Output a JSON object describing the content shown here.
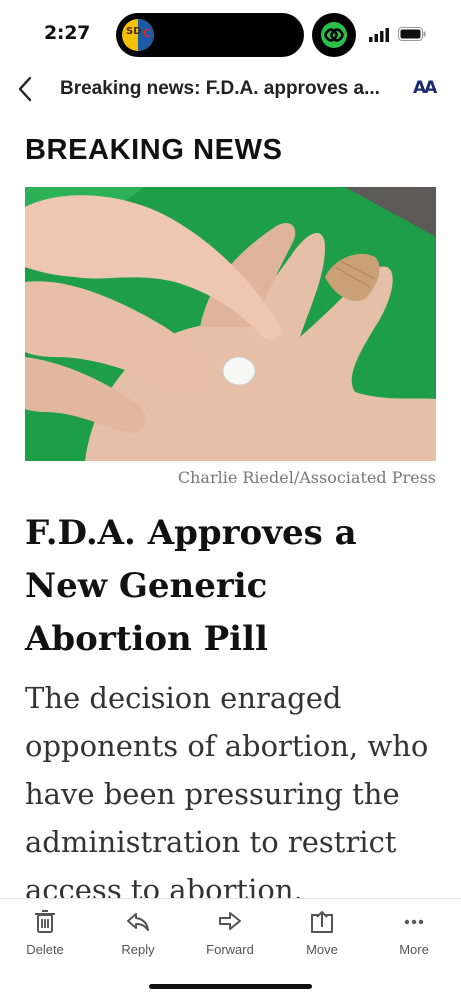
{
  "status_bar": {
    "time": "2:27",
    "island_app_logo_letters": "SD",
    "island_app_logo_letter_right": "C",
    "accent_green": "#2ac04a"
  },
  "nav": {
    "title": "Breaking news: F.D.A. approves a...",
    "text_size_label": "AA"
  },
  "article": {
    "kicker": "BREAKING NEWS",
    "photo_credit": "Charlie Riedel/Associated Press",
    "headline": "F.D.A. Approves a New Generic Abortion Pill",
    "summary": "The decision enraged opponents of abortion, who have been pressuring the administration to restrict access to abortion."
  },
  "toolbar": {
    "items": [
      {
        "label": "Delete",
        "icon": "trash-icon"
      },
      {
        "label": "Reply",
        "icon": "reply-icon"
      },
      {
        "label": "Forward",
        "icon": "forward-icon"
      },
      {
        "label": "Move",
        "icon": "move-icon"
      },
      {
        "label": "More",
        "icon": "more-icon"
      }
    ]
  }
}
